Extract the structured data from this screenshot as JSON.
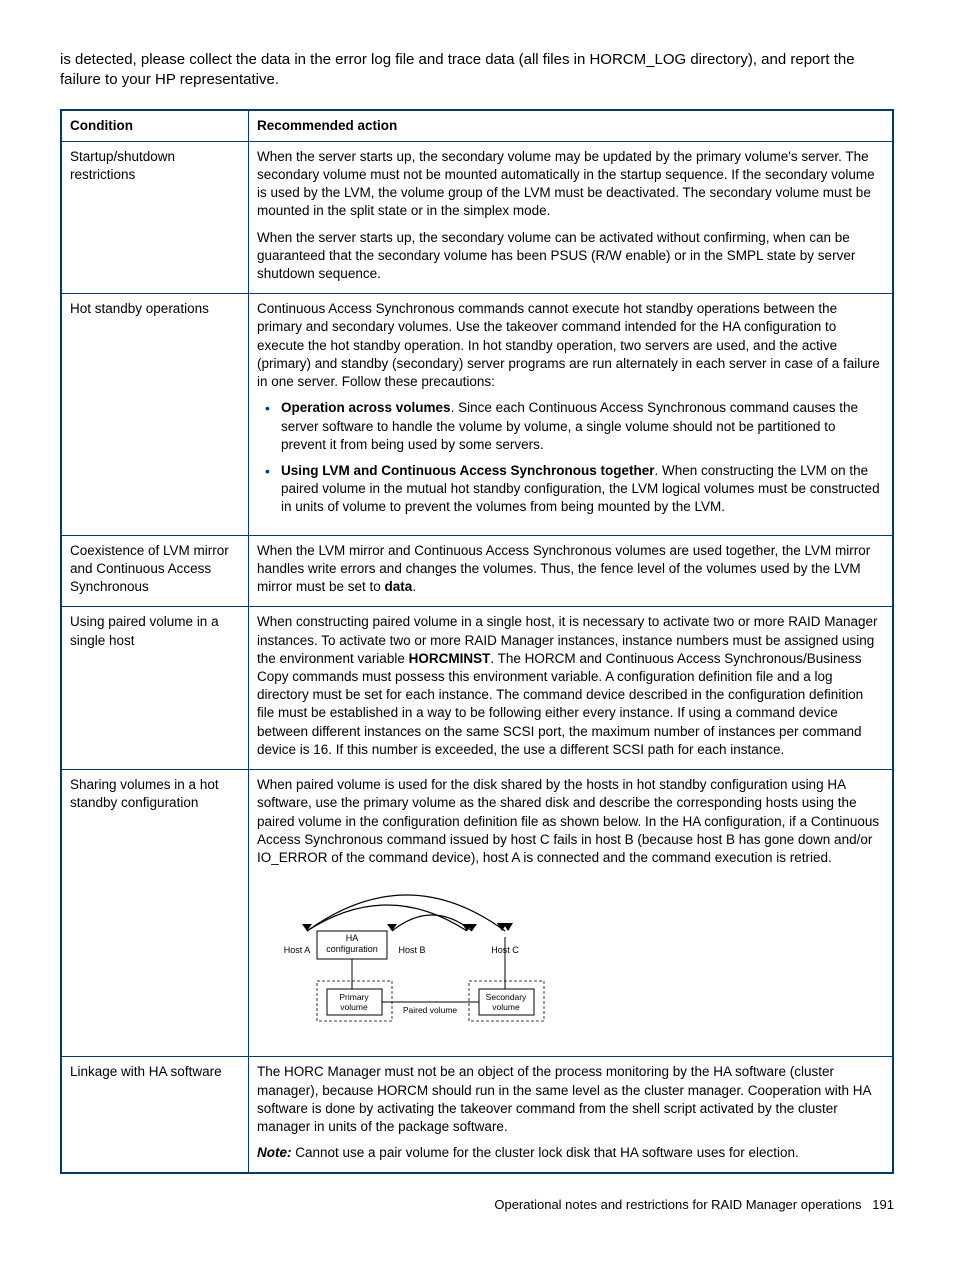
{
  "intro": "is detected, please collect the data in the error log file and trace data (all files in HORCM_LOG directory), and report the failure to your HP representative.",
  "table": {
    "headers": {
      "c1": "Condition",
      "c2": "Recommended action"
    },
    "rows": [
      {
        "condition": "Startup/shutdown restrictions",
        "paras": [
          "When the server starts up, the secondary volume may be updated by the primary volume's server. The secondary volume must not be mounted automatically in the startup sequence. If the secondary volume is used by the LVM, the volume group of the LVM must be deactivated. The secondary volume must be mounted in the split state or in the simplex mode.",
          "When the server starts up, the secondary volume can be activated without confirming, when can be guaranteed that the secondary volume has been PSUS (R/W enable) or in the SMPL state by server shutdown sequence."
        ]
      },
      {
        "condition": "Hot standby operations",
        "paras": [
          "Continuous Access Synchronous commands cannot execute hot standby operations between the primary and secondary volumes. Use the takeover command intended for the HA configuration to execute the hot standby operation. In hot standby operation, two servers are used, and the active (primary) and standby (secondary) server programs are run alternately in each server in case of a failure in one server. Follow these precautions:"
        ],
        "bullets": [
          {
            "lead": "Operation across volumes",
            "rest": ". Since each Continuous Access Synchronous command causes the server software to handle the volume by volume, a single volume should not be partitioned to prevent it from being used by some servers."
          },
          {
            "lead": "Using LVM and Continuous Access Synchronous together",
            "rest": ". When constructing the LVM on the paired volume in the mutual hot standby configuration, the LVM logical volumes must be constructed in units of volume to prevent the volumes from being mounted by the LVM."
          }
        ]
      },
      {
        "condition": "Coexistence of LVM mirror and Continuous Access Synchronous",
        "action_pre": "When the LVM mirror and Continuous Access Synchronous volumes are used together, the LVM mirror handles write errors and changes the volumes. Thus, the fence level of the volumes used by the LVM mirror must be set to ",
        "action_bold": "data",
        "action_post": "."
      },
      {
        "condition": "Using paired volume in a single host",
        "action_pre": "When constructing paired volume in a single host, it is necessary to activate two or more RAID Manager instances. To activate two or more RAID Manager instances, instance numbers must be assigned using the environment variable ",
        "action_bold": "HORCMINST",
        "action_post": ". The HORCM and Continuous Access Synchronous/Business Copy commands must possess this environment variable. A configuration definition file and a log directory must be set for each instance. The command device described in the configuration definition file must be established in a way to be following either every instance. If using a command device between different instances on the same SCSI port, the maximum number of instances per command device is 16. If this number is exceeded, the use a different SCSI path for each instance."
      },
      {
        "condition": "Sharing volumes in a hot standby configuration",
        "paras": [
          "When paired volume is used for the disk shared by the hosts in hot standby configuration using HA software, use the primary volume as the shared disk and describe the corresponding hosts using the paired volume in the configuration definition file as shown below. In the HA configuration, if a Continuous Access Synchronous command issued by host C fails in host B (because host B has gone down and/or IO_ERROR of the command device), host A is connected and the command execution is retried."
        ],
        "diagram": {
          "hostA": "Host A",
          "haConfig": "HA configuration",
          "hostB": "Host B",
          "hostC": "Host C",
          "primary": "Primary volume",
          "paired": "Paired volume",
          "secondary": "Secondary volume"
        }
      },
      {
        "condition": "Linkage with HA software",
        "paras": [
          "The HORC Manager must not be an object of the process monitoring by the HA software (cluster manager), because HORCM should run in the same level as the cluster manager. Cooperation with HA software is done by activating the takeover command from the shell script activated by the cluster manager in units of the package software."
        ],
        "note_lead": "Note:",
        "note_rest": " Cannot use a pair volume for the cluster lock disk that HA software uses for election."
      }
    ]
  },
  "footer": {
    "text": "Operational notes and restrictions for RAID Manager operations",
    "page": "191"
  }
}
